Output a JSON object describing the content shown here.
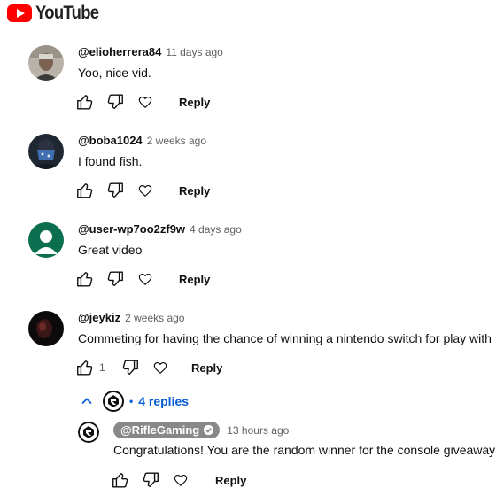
{
  "header": {
    "logo_text": "YouTube",
    "logo_color": "#ff0000"
  },
  "comments": [
    {
      "author": "@elioherrera84",
      "time": "11 days ago",
      "text": "Yoo, nice vid.",
      "likes": "",
      "reply_label": "Reply"
    },
    {
      "author": "@boba1024",
      "time": "2 weeks ago",
      "text": "I found fish.",
      "likes": "",
      "reply_label": "Reply"
    },
    {
      "author": "@user-wp7oo2zf9w",
      "time": "4 days ago",
      "text": "Great video",
      "likes": "",
      "reply_label": "Reply"
    },
    {
      "author": "@jeykiz",
      "time": "2 weeks ago",
      "text": "Commeting for having the chance of winning a nintendo switch for play with",
      "likes": "1",
      "reply_label": "Reply"
    }
  ],
  "replies_toggle": {
    "label": "4 replies",
    "separator": "•",
    "link_color": "#065fd4"
  },
  "reply": {
    "author": "@RifleGaming",
    "time": "13 hours ago",
    "text": "Congratulations! You are the random winner for the console giveaway",
    "reply_label": "Reply"
  },
  "icons": [
    "thumb-up-icon",
    "thumb-down-icon",
    "heart-icon",
    "chevron-up-icon",
    "verified-check-icon",
    "channel-logo-icon"
  ]
}
